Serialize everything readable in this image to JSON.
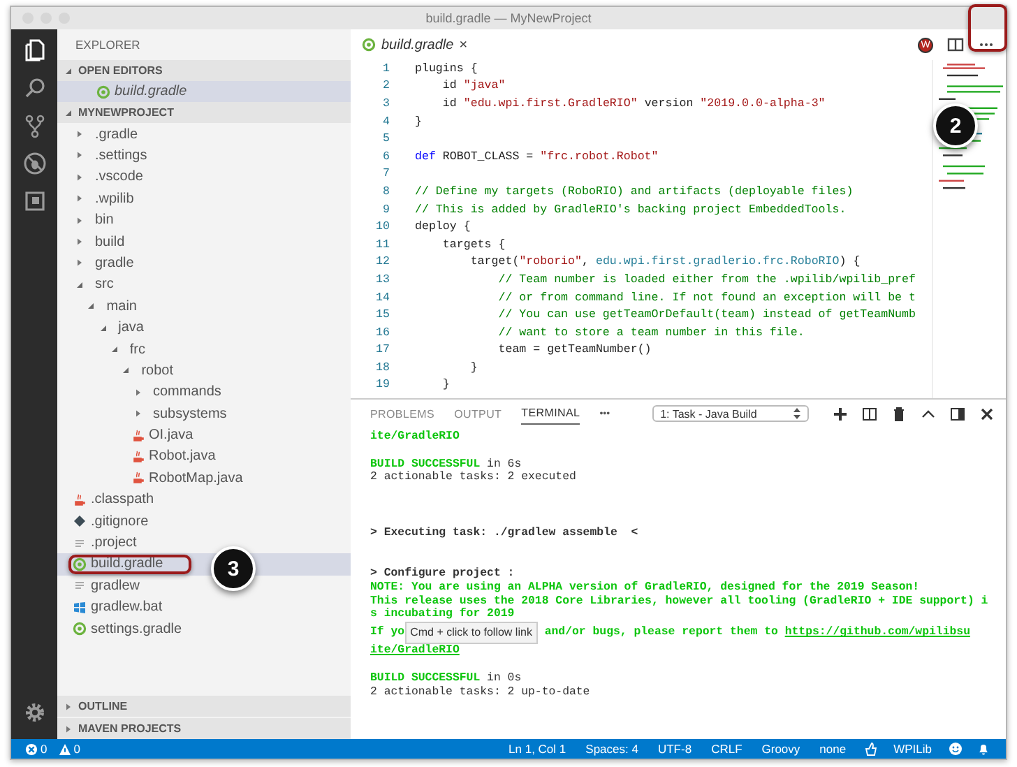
{
  "window": {
    "title": "build.gradle — MyNewProject"
  },
  "sidebar": {
    "title": "EXPLORER",
    "sections": [
      {
        "title": "OPEN EDITORS",
        "expanded": true,
        "items": [
          {
            "name": "build.gradle",
            "kind": "gradle",
            "selected": true
          }
        ]
      },
      {
        "title": "MYNEWPROJECT",
        "expanded": true,
        "items": [
          {
            "name": ".gradle",
            "kind": "folder",
            "expanded": false,
            "selected": false,
            "highlighted": false
          },
          {
            "name": ".settings",
            "kind": "folder",
            "expanded": false,
            "selected": false,
            "highlighted": false
          },
          {
            "name": ".vscode",
            "kind": "folder",
            "expanded": false,
            "selected": false,
            "highlighted": false
          },
          {
            "name": ".wpilib",
            "kind": "folder",
            "expanded": false,
            "selected": false,
            "highlighted": false
          },
          {
            "name": "bin",
            "kind": "folder",
            "expanded": false,
            "selected": false,
            "highlighted": false
          },
          {
            "name": "build",
            "kind": "folder",
            "expanded": false,
            "selected": false,
            "highlighted": false
          },
          {
            "name": "gradle",
            "kind": "folder",
            "expanded": false,
            "selected": false,
            "highlighted": false
          },
          {
            "name": "src",
            "kind": "folder",
            "expanded": true,
            "selected": false,
            "highlighted": false,
            "children": [
              {
                "name": "main",
                "kind": "folder",
                "expanded": true,
                "selected": false,
                "highlighted": false,
                "children": [
                  {
                    "name": "java",
                    "kind": "folder",
                    "expanded": true,
                    "selected": false,
                    "highlighted": false,
                    "children": [
                      {
                        "name": "frc",
                        "kind": "folder",
                        "expanded": true,
                        "selected": false,
                        "highlighted": false,
                        "children": [
                          {
                            "name": "robot",
                            "kind": "folder",
                            "expanded": true,
                            "selected": false,
                            "highlighted": false,
                            "children": [
                              {
                                "name": "commands",
                                "kind": "folder",
                                "expanded": false,
                                "selected": false,
                                "highlighted": false
                              },
                              {
                                "name": "subsystems",
                                "kind": "folder",
                                "expanded": false,
                                "selected": false,
                                "highlighted": false
                              },
                              {
                                "name": "OI.java",
                                "kind": "java",
                                "selected": false,
                                "highlighted": false
                              },
                              {
                                "name": "Robot.java",
                                "kind": "java",
                                "selected": false,
                                "highlighted": false
                              },
                              {
                                "name": "RobotMap.java",
                                "kind": "java",
                                "selected": false,
                                "highlighted": false
                              }
                            ]
                          }
                        ]
                      }
                    ]
                  }
                ]
              }
            ]
          },
          {
            "name": ".classpath",
            "kind": "java",
            "selected": false,
            "highlighted": false
          },
          {
            "name": ".gitignore",
            "kind": "git",
            "selected": false,
            "highlighted": false
          },
          {
            "name": ".project",
            "kind": "text",
            "selected": false,
            "highlighted": false
          },
          {
            "name": "build.gradle",
            "kind": "gradle",
            "selected": true,
            "highlighted": true
          },
          {
            "name": "gradlew",
            "kind": "text",
            "selected": false,
            "highlighted": false
          },
          {
            "name": "gradlew.bat",
            "kind": "windows",
            "selected": false,
            "highlighted": false
          },
          {
            "name": "settings.gradle",
            "kind": "gradle",
            "selected": false,
            "highlighted": false
          }
        ]
      }
    ],
    "bottom_sections": [
      {
        "title": "OUTLINE",
        "expanded": false
      },
      {
        "title": "MAVEN PROJECTS",
        "expanded": false
      }
    ]
  },
  "editor": {
    "tabs": [
      {
        "label": "build.gradle",
        "kind": "gradle",
        "selected": true,
        "close": "×"
      }
    ],
    "extension_badge": "W",
    "lines": [
      {
        "number": "1",
        "segments": [
          {
            "kind": "plain",
            "text": "plugins {"
          }
        ]
      },
      {
        "number": "2",
        "segments": [
          {
            "kind": "plain",
            "text": "    id "
          },
          {
            "kind": "string",
            "text": "\"java\""
          }
        ]
      },
      {
        "number": "3",
        "segments": [
          {
            "kind": "plain",
            "text": "    id "
          },
          {
            "kind": "string",
            "text": "\"edu.wpi.first.GradleRIO\""
          },
          {
            "kind": "plain",
            "text": " version "
          },
          {
            "kind": "string",
            "text": "\"2019.0.0-alpha-3\""
          }
        ]
      },
      {
        "number": "4",
        "segments": [
          {
            "kind": "plain",
            "text": "}"
          }
        ]
      },
      {
        "number": "5"
      },
      {
        "number": "6",
        "segments": [
          {
            "kind": "keyword",
            "text": "def"
          },
          {
            "kind": "plain",
            "text": " ROBOT_CLASS = "
          },
          {
            "kind": "string",
            "text": "\"frc.robot.Robot\""
          }
        ]
      },
      {
        "number": "7"
      },
      {
        "number": "8",
        "segments": [
          {
            "kind": "comment",
            "text": "// Define my targets (RoboRIO) and artifacts (deployable files)"
          }
        ]
      },
      {
        "number": "9",
        "segments": [
          {
            "kind": "comment",
            "text": "// This is added by GradleRIO's backing project EmbeddedTools."
          }
        ]
      },
      {
        "number": "10",
        "segments": [
          {
            "kind": "plain",
            "text": "deploy {"
          }
        ]
      },
      {
        "number": "11",
        "segments": [
          {
            "kind": "plain",
            "text": "    targets {"
          }
        ]
      },
      {
        "number": "12",
        "segments": [
          {
            "kind": "plain",
            "text": "        target("
          },
          {
            "kind": "string",
            "text": "\"roborio\""
          },
          {
            "kind": "plain",
            "text": ", "
          },
          {
            "kind": "type",
            "text": "edu.wpi.first.gradlerio.frc.RoboRIO"
          },
          {
            "kind": "plain",
            "text": ") {"
          }
        ]
      },
      {
        "number": "13",
        "segments": [
          {
            "kind": "comment",
            "text": "            // Team number is loaded either from the .wpilib/wpilib_pref"
          }
        ]
      },
      {
        "number": "14",
        "segments": [
          {
            "kind": "comment",
            "text": "            // or from command line. If not found an exception will be t"
          }
        ]
      },
      {
        "number": "15",
        "segments": [
          {
            "kind": "comment",
            "text": "            // You can use getTeamOrDefault(team) instead of getTeamNumb"
          }
        ]
      },
      {
        "number": "16",
        "segments": [
          {
            "kind": "comment",
            "text": "            // want to store a team number in this file."
          }
        ]
      },
      {
        "number": "17",
        "segments": [
          {
            "kind": "plain",
            "text": "            team = getTeamNumber()"
          }
        ]
      },
      {
        "number": "18",
        "segments": [
          {
            "kind": "plain",
            "text": "        }"
          }
        ]
      },
      {
        "number": "19",
        "segments": [
          {
            "kind": "plain",
            "text": "    }"
          }
        ]
      }
    ]
  },
  "panel": {
    "tabs": [
      {
        "label": "PROBLEMS",
        "selected": false
      },
      {
        "label": "OUTPUT",
        "selected": false
      },
      {
        "label": "TERMINAL",
        "selected": true
      }
    ],
    "more": "•••",
    "terminal_select": "1: Task - Java Build",
    "terminal": [
      {
        "kind": "text",
        "segments": [
          {
            "kind": "green",
            "text": "ite/GradleRIO"
          }
        ]
      },
      {
        "kind": "blank"
      },
      {
        "kind": "text",
        "segments": [
          {
            "kind": "green",
            "text": "BUILD SUCCESSFUL"
          },
          {
            "kind": "plain",
            "text": " in 6s"
          }
        ]
      },
      {
        "kind": "text",
        "segments": [
          {
            "kind": "plain",
            "text": "2 actionable tasks: 2 executed"
          }
        ]
      },
      {
        "kind": "blank"
      },
      {
        "kind": "blank"
      },
      {
        "kind": "blank"
      },
      {
        "kind": "text",
        "segments": [
          {
            "kind": "bold",
            "text": "> Executing task: ./gradlew assemble  <"
          }
        ]
      },
      {
        "kind": "blank"
      },
      {
        "kind": "blank"
      },
      {
        "kind": "text",
        "segments": [
          {
            "kind": "bold",
            "text": "> Configure project :"
          }
        ]
      },
      {
        "kind": "text",
        "segments": [
          {
            "kind": "green",
            "text": "NOTE: You are using an ALPHA version of GradleRIO, designed for the 2019 Season!"
          }
        ]
      },
      {
        "kind": "text",
        "segments": [
          {
            "kind": "green",
            "text": "This release uses the 2018 Core Libraries, however all tooling (GradleRIO + IDE support) i"
          }
        ]
      },
      {
        "kind": "text",
        "segments": [
          {
            "kind": "green",
            "text": "s incubating for 2019"
          }
        ]
      },
      {
        "kind": "text",
        "segments": [
          {
            "kind": "green",
            "text": "If yo"
          },
          {
            "kind": "tooltip",
            "text": "Cmd + click to follow link"
          },
          {
            "kind": "green",
            "text": " and/or bugs, please report them to "
          },
          {
            "kind": "link",
            "text": "https://github.com/wpilibsu"
          }
        ]
      },
      {
        "kind": "text",
        "segments": [
          {
            "kind": "link",
            "text": "ite/GradleRIO"
          }
        ]
      },
      {
        "kind": "blank"
      },
      {
        "kind": "text",
        "segments": [
          {
            "kind": "green",
            "text": "BUILD SUCCESSFUL"
          },
          {
            "kind": "plain",
            "text": " in 0s"
          }
        ]
      },
      {
        "kind": "text",
        "segments": [
          {
            "kind": "plain",
            "text": "2 actionable tasks: 2 up-to-date"
          }
        ]
      }
    ]
  },
  "status_bar": {
    "left": [
      {
        "kind": "errors",
        "text": "0"
      },
      {
        "kind": "warnings",
        "text": "0"
      }
    ],
    "right": [
      {
        "kind": "text",
        "text": "Ln 1, Col 1"
      },
      {
        "kind": "text",
        "text": "Spaces: 4"
      },
      {
        "kind": "text",
        "text": "UTF-8"
      },
      {
        "kind": "text",
        "text": "CRLF"
      },
      {
        "kind": "text",
        "text": "Groovy"
      },
      {
        "kind": "text",
        "text": "none"
      },
      {
        "kind": "hand"
      },
      {
        "kind": "text",
        "text": "WPILib"
      },
      {
        "kind": "smiley"
      },
      {
        "kind": "bell"
      }
    ]
  },
  "callouts": [
    {
      "label": "2",
      "kind": "more-actions"
    },
    {
      "label": "3",
      "kind": "build-file"
    }
  ]
}
